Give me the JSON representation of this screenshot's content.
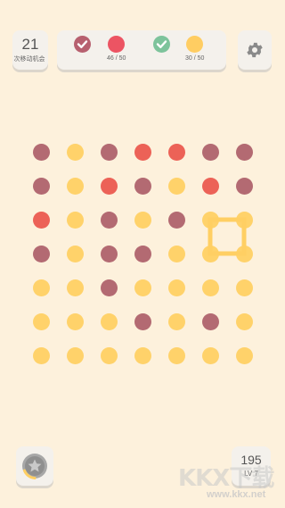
{
  "hud": {
    "moves_count": "21",
    "moves_label": "次移动机会"
  },
  "goals": [
    {
      "color": "#b7606f",
      "completed": true,
      "progress": ""
    },
    {
      "color": "#ec5463",
      "completed": false,
      "progress": "46 / 50"
    },
    {
      "color": "#7dc39b",
      "completed": true,
      "progress": ""
    },
    {
      "color": "#ffcd62",
      "completed": false,
      "progress": "30 / 50"
    }
  ],
  "colors": {
    "mauve": "#b36a72",
    "red": "#ec6257",
    "yellow": "#ffd26a",
    "path": "#ffcf63",
    "background": "#fdf1dc",
    "panel": "#f4f1ec"
  },
  "board": {
    "rows": [
      [
        "m",
        "y",
        "m",
        "r",
        "r",
        "m",
        "m"
      ],
      [
        "m",
        "y",
        "r",
        "m",
        "y",
        "r",
        "m"
      ],
      [
        "r",
        "y",
        "m",
        "y",
        "m",
        "y",
        "y"
      ],
      [
        "m",
        "y",
        "m",
        "m",
        "y",
        "y",
        "y"
      ],
      [
        "y",
        "y",
        "m",
        "y",
        "y",
        "y",
        "y"
      ],
      [
        "y",
        "y",
        "y",
        "m",
        "y",
        "m",
        "y"
      ],
      [
        "y",
        "y",
        "y",
        "y",
        "y",
        "y",
        "y"
      ]
    ],
    "selected_square": {
      "row_start": 2,
      "col_start": 5,
      "size": 2
    }
  },
  "footer": {
    "powerup_icon": "star-icon",
    "score": "195",
    "level": "LV 7"
  },
  "watermark": {
    "text": "KKX下载",
    "url": "www.kkx.net"
  }
}
